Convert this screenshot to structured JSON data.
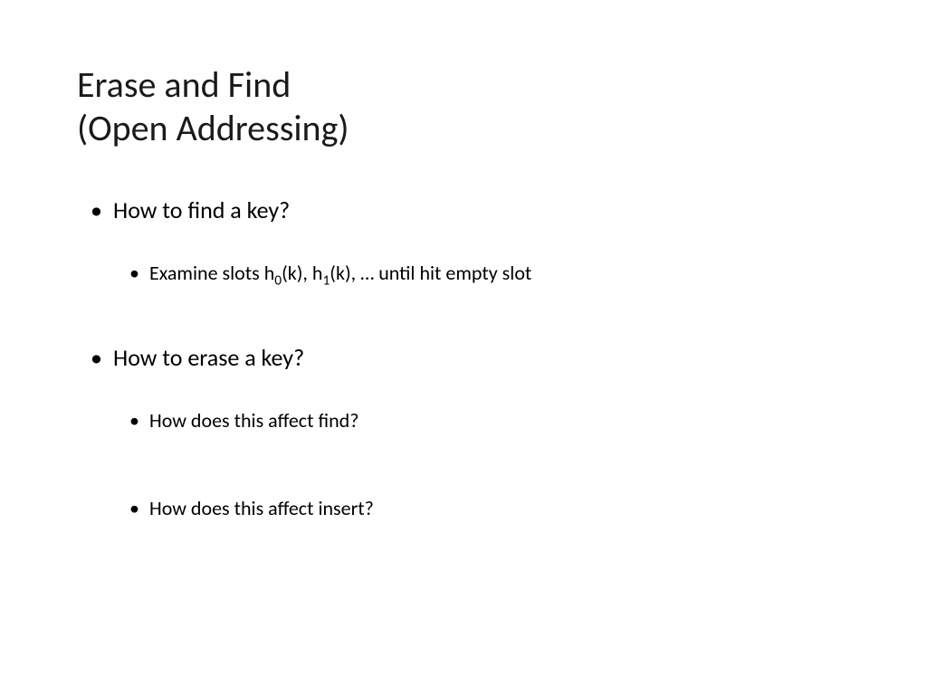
{
  "title_line1": "Erase and Find",
  "title_line2": "(Open Addressing)",
  "bullets": {
    "q1": "How to find a key?",
    "q1_sub": {
      "prefix": "Examine slots h",
      "sub0": "0",
      "mid1": "(k), h",
      "sub1": "1",
      "suffix": "(k), … until hit empty slot"
    },
    "q2": "How to erase a key?",
    "q2_sub1": "How does this affect find?",
    "q2_sub2": "How does this affect insert?"
  }
}
